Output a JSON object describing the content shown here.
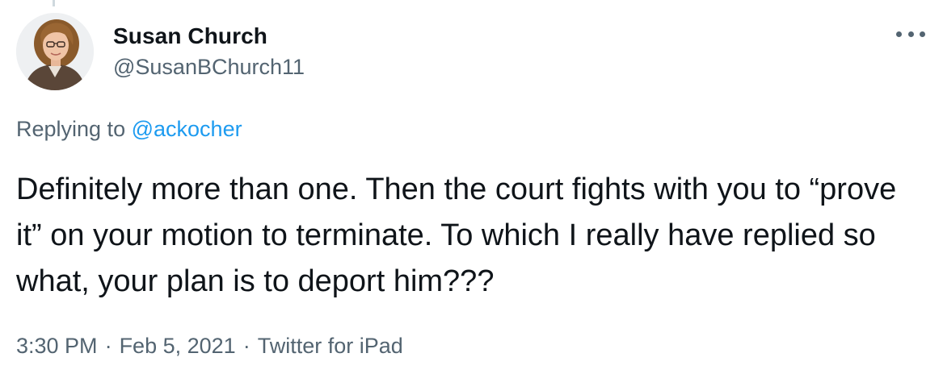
{
  "author": {
    "name": "Susan Church",
    "handle": "@SusanBChurch11",
    "avatar": "profile-photo"
  },
  "reply": {
    "prefix": "Replying to",
    "mention": "@ackocher"
  },
  "tweet": {
    "text": "Definitely more than one. Then the court fights with you to “prove it” on your motion to terminate. To which I really have replied so what, your plan is to deport him???"
  },
  "meta": {
    "time": "3:30 PM",
    "separator": "·",
    "date": "Feb 5, 2021",
    "source": "Twitter for iPad"
  },
  "icons": {
    "more": "more-options-icon"
  },
  "colors": {
    "text_primary": "#0f1419",
    "text_secondary": "#536471",
    "link": "#1d9bf0"
  }
}
